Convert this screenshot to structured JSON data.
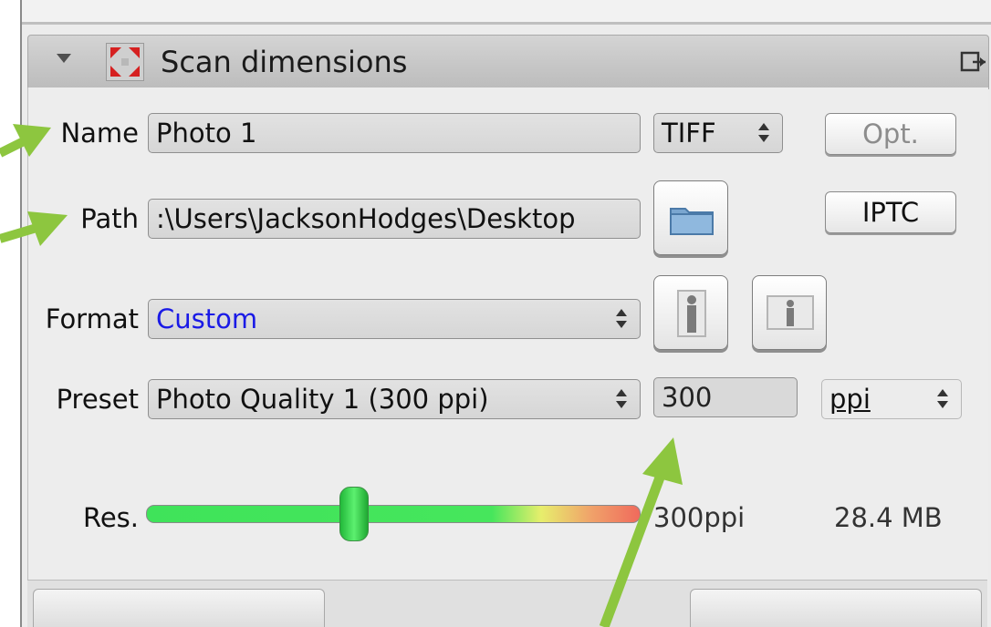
{
  "panel": {
    "title": "Scan dimensions",
    "header_icons": [
      "collapse-triangle-icon",
      "scan-area-icon",
      "detach-panel-icon"
    ]
  },
  "name_row": {
    "label": "Name",
    "value": "Photo 1",
    "file_type": "TIFF",
    "options_button": "Opt."
  },
  "path_row": {
    "label": "Path",
    "value": ":\\Users\\JacksonHodges\\Desktop",
    "folder_icon": "folder-icon",
    "iptc_button": "IPTC"
  },
  "format_row": {
    "label": "Format",
    "value": "Custom",
    "orientation_icons": [
      "portrait-orientation-icon",
      "landscape-orientation-icon"
    ]
  },
  "preset_row": {
    "label": "Preset",
    "value": "Photo Quality 1 (300 ppi)",
    "resolution_value": "300",
    "unit": "ppi"
  },
  "resolution_row": {
    "label": "Res.",
    "slider_fraction": 0.42,
    "value_text": "300ppi",
    "file_size": "28.4 MB"
  },
  "colors": {
    "annotation_arrow": "#8dc63f",
    "format_value": "#1a1ae6"
  }
}
